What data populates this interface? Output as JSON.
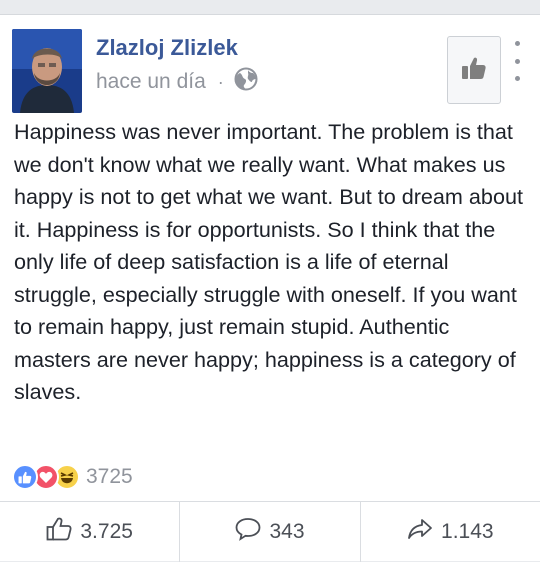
{
  "post": {
    "author": "Zlazloj Zlizlek",
    "timestamp": "hace un día",
    "separator": "·",
    "privacy_icon": "globe-icon",
    "text": "Happiness was never important. The problem is that we don't know what we really want. What makes us happy is not to get what we want. But to dream about it. Happiness is for opportunists. So I think that the only life of deep satisfaction is a life of eternal struggle, especially struggle with oneself. If you want to remain happy, just remain stupid. Authentic masters are never happy; happiness is a category of slaves."
  },
  "header_buttons": {
    "like_page_icon": "thumbs-up-icon",
    "more_icon": "more-vertical-icon"
  },
  "reactions": {
    "icons": [
      "like-icon",
      "love-icon",
      "haha-icon"
    ],
    "count": "3725"
  },
  "actions": {
    "like": {
      "icon": "thumbs-up-outline-icon",
      "label": "3.725"
    },
    "comment": {
      "icon": "comment-icon",
      "label": "343"
    },
    "share": {
      "icon": "share-icon",
      "label": "1.143"
    }
  },
  "colors": {
    "author_name": "#3b5998",
    "meta_text": "#90949c",
    "body_text": "#1d2129",
    "like_reaction": "#5890ff",
    "love_reaction": "#f25268",
    "haha_reaction": "#f7d14a"
  }
}
